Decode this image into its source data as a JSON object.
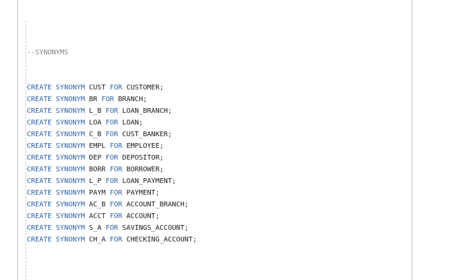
{
  "comment": "--SYNONYMS",
  "keywords": {
    "create": "CREATE",
    "synonym": "SYNONYM",
    "for": "FOR"
  },
  "statements": [
    {
      "alias": "CUST",
      "target": "CUSTOMER;"
    },
    {
      "alias": "BR",
      "target": "BRANCH;"
    },
    {
      "alias": "L_B",
      "target": "LOAN_BRANCH;"
    },
    {
      "alias": "LOA",
      "target": "LOAN;"
    },
    {
      "alias": "C_B",
      "target": "CUST_BANKER;"
    },
    {
      "alias": "EMPL",
      "target": "EMPLOYEE;"
    },
    {
      "alias": "DEP",
      "target": "DEPOSITOR;"
    },
    {
      "alias": "BORR",
      "target": "BORROWER;"
    },
    {
      "alias": "L_P",
      "target": "LOAN_PAYMENT;"
    },
    {
      "alias": "PAYM",
      "target": "PAYMENT;"
    },
    {
      "alias": "AC_B",
      "target": "ACCOUNT_BRANCH;"
    },
    {
      "alias": "ACCT",
      "target": "ACCOUNT;"
    },
    {
      "alias": "S_A",
      "target": "SAVINGS_ACCOUNT;"
    },
    {
      "alias": "CH_A",
      "target": "CHECKING_ACCOUNT;"
    }
  ],
  "colors": {
    "keyword": "#2e5fa8",
    "comment": "#808080",
    "text": "#1a1a1a"
  }
}
